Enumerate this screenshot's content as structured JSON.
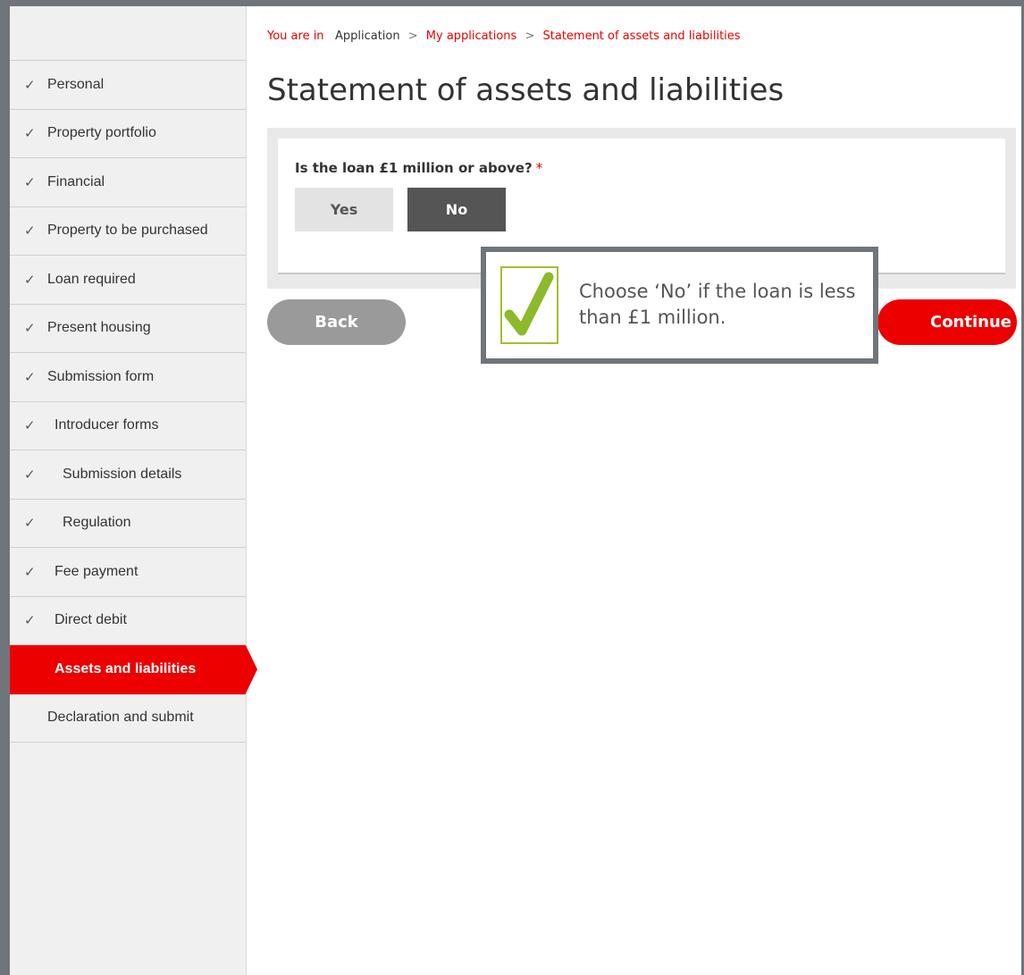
{
  "breadcrumb": {
    "prefix": "You are in",
    "items": [
      "Application",
      "My applications",
      "Statement of assets and liabilities"
    ],
    "separator": ">"
  },
  "page": {
    "title": "Statement of assets and liabilities"
  },
  "sidebar": {
    "items": [
      {
        "label": "Personal",
        "checked": true
      },
      {
        "label": "Property portfolio",
        "checked": true
      },
      {
        "label": "Financial",
        "checked": true
      },
      {
        "label": "Property to be purchased",
        "checked": true
      },
      {
        "label": "Loan required",
        "checked": true
      },
      {
        "label": "Present housing",
        "checked": true
      },
      {
        "label": "Submission form",
        "checked": true
      },
      {
        "label": "Introducer forms",
        "checked": true
      },
      {
        "label": "Submission details",
        "checked": true
      },
      {
        "label": "Regulation",
        "checked": true
      },
      {
        "label": "Fee payment",
        "checked": true
      },
      {
        "label": "Direct debit",
        "checked": true
      },
      {
        "label": "Assets and liabilities",
        "checked": false,
        "active": true
      },
      {
        "label": "Declaration and submit",
        "checked": false
      }
    ],
    "check_glyph": "✓"
  },
  "form": {
    "question": "Is the loan £1 million or above?",
    "required_marker": "*",
    "options": {
      "yes": "Yes",
      "no": "No"
    },
    "selected": "No"
  },
  "actions": {
    "back": "Back",
    "continue": "Continue"
  },
  "tooltip": {
    "text": "Choose ‘No’ if the loan is less than £1 million.",
    "icon": "check-icon"
  },
  "colors": {
    "brand_red": "#ec0000",
    "frame_grey": "#6f757b",
    "check_green": "#8dba2b"
  }
}
